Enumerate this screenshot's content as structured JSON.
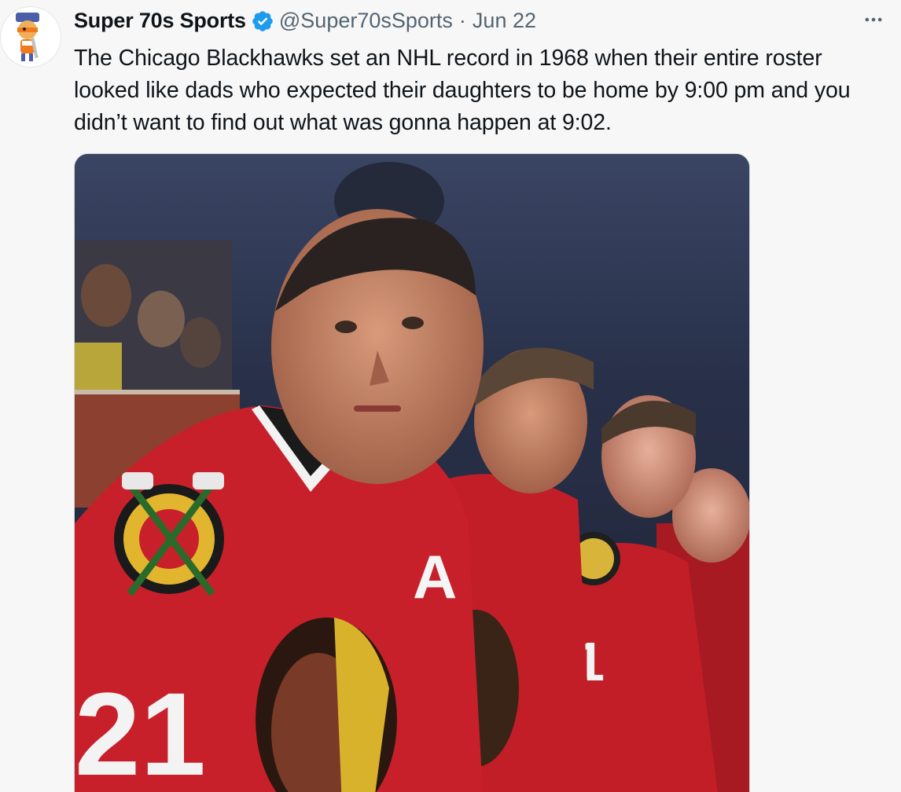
{
  "tweet": {
    "author": {
      "display_name": "Super 70s Sports",
      "handle": "@Super70sSports",
      "verified": true,
      "avatar_icon": "cartoon-mascot-avatar-icon"
    },
    "separator": "·",
    "date": "Jun 22",
    "more_icon": "ellipsis-icon",
    "text": "The Chicago Blackhawks set an NHL record in 1968 when their entire roster looked like dads who expected their daughters to be home by 9:00 pm and you didn’t want to find out what was gonna happen at 9:02.",
    "media": {
      "kind": "photo",
      "jersey_numbers": [
        "21",
        "11"
      ],
      "sleeve_letter": "A"
    }
  },
  "colors": {
    "verified_blue": "#1d9bf0",
    "text_primary": "#0f1419",
    "text_secondary": "#536471",
    "jersey_red": "#c8202a"
  }
}
